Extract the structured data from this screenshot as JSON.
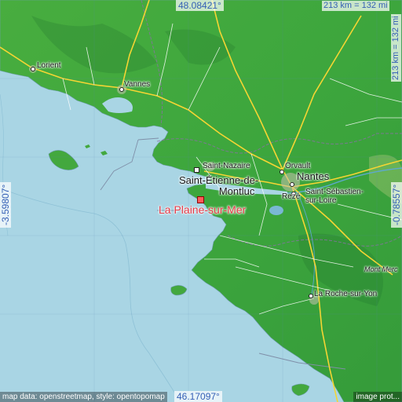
{
  "place": {
    "name": "La Plaine-sur-Mer",
    "marker_color": "#ff5a5a",
    "label_color": "#e63946"
  },
  "coordinates": {
    "north": "48.08421°",
    "south": "46.17097°",
    "west": "-3.59807°",
    "east": "-0.78557°"
  },
  "scale": {
    "horizontal": "213 km = 132 mi",
    "vertical": "213 km = 132 mi"
  },
  "cities": [
    {
      "id": "lorient",
      "label": "Lorient"
    },
    {
      "id": "vannes",
      "label": "Vannes"
    },
    {
      "id": "saint-etienne-de-montluc",
      "label": "Saint-Étienne-de-\nMontluc"
    },
    {
      "id": "saint-nazaire",
      "label": "Saint-Nazaire"
    },
    {
      "id": "nantes",
      "label": "Nantes"
    },
    {
      "id": "orvault",
      "label": "Orvault"
    },
    {
      "id": "reze",
      "label": "Rezé"
    },
    {
      "id": "saint-sebastien-sur-loire",
      "label": "Saint-Sébastien-\nsur-Loire"
    },
    {
      "id": "mont-merc",
      "label": "Mont Merc"
    },
    {
      "id": "la-roche-sur-yon",
      "label": "La Roche-sur-Yon"
    }
  ],
  "attribution": "map data: openstreetmap, style: opentopomap",
  "image_credit": "image prot...",
  "colors": {
    "sea": "#a9d5e4",
    "land": "#3aa83a",
    "land_dark": "#2f8f35",
    "coordinate_text": "#3560b6",
    "road_major": "#f5d533",
    "road_minor": "#ffffff"
  }
}
